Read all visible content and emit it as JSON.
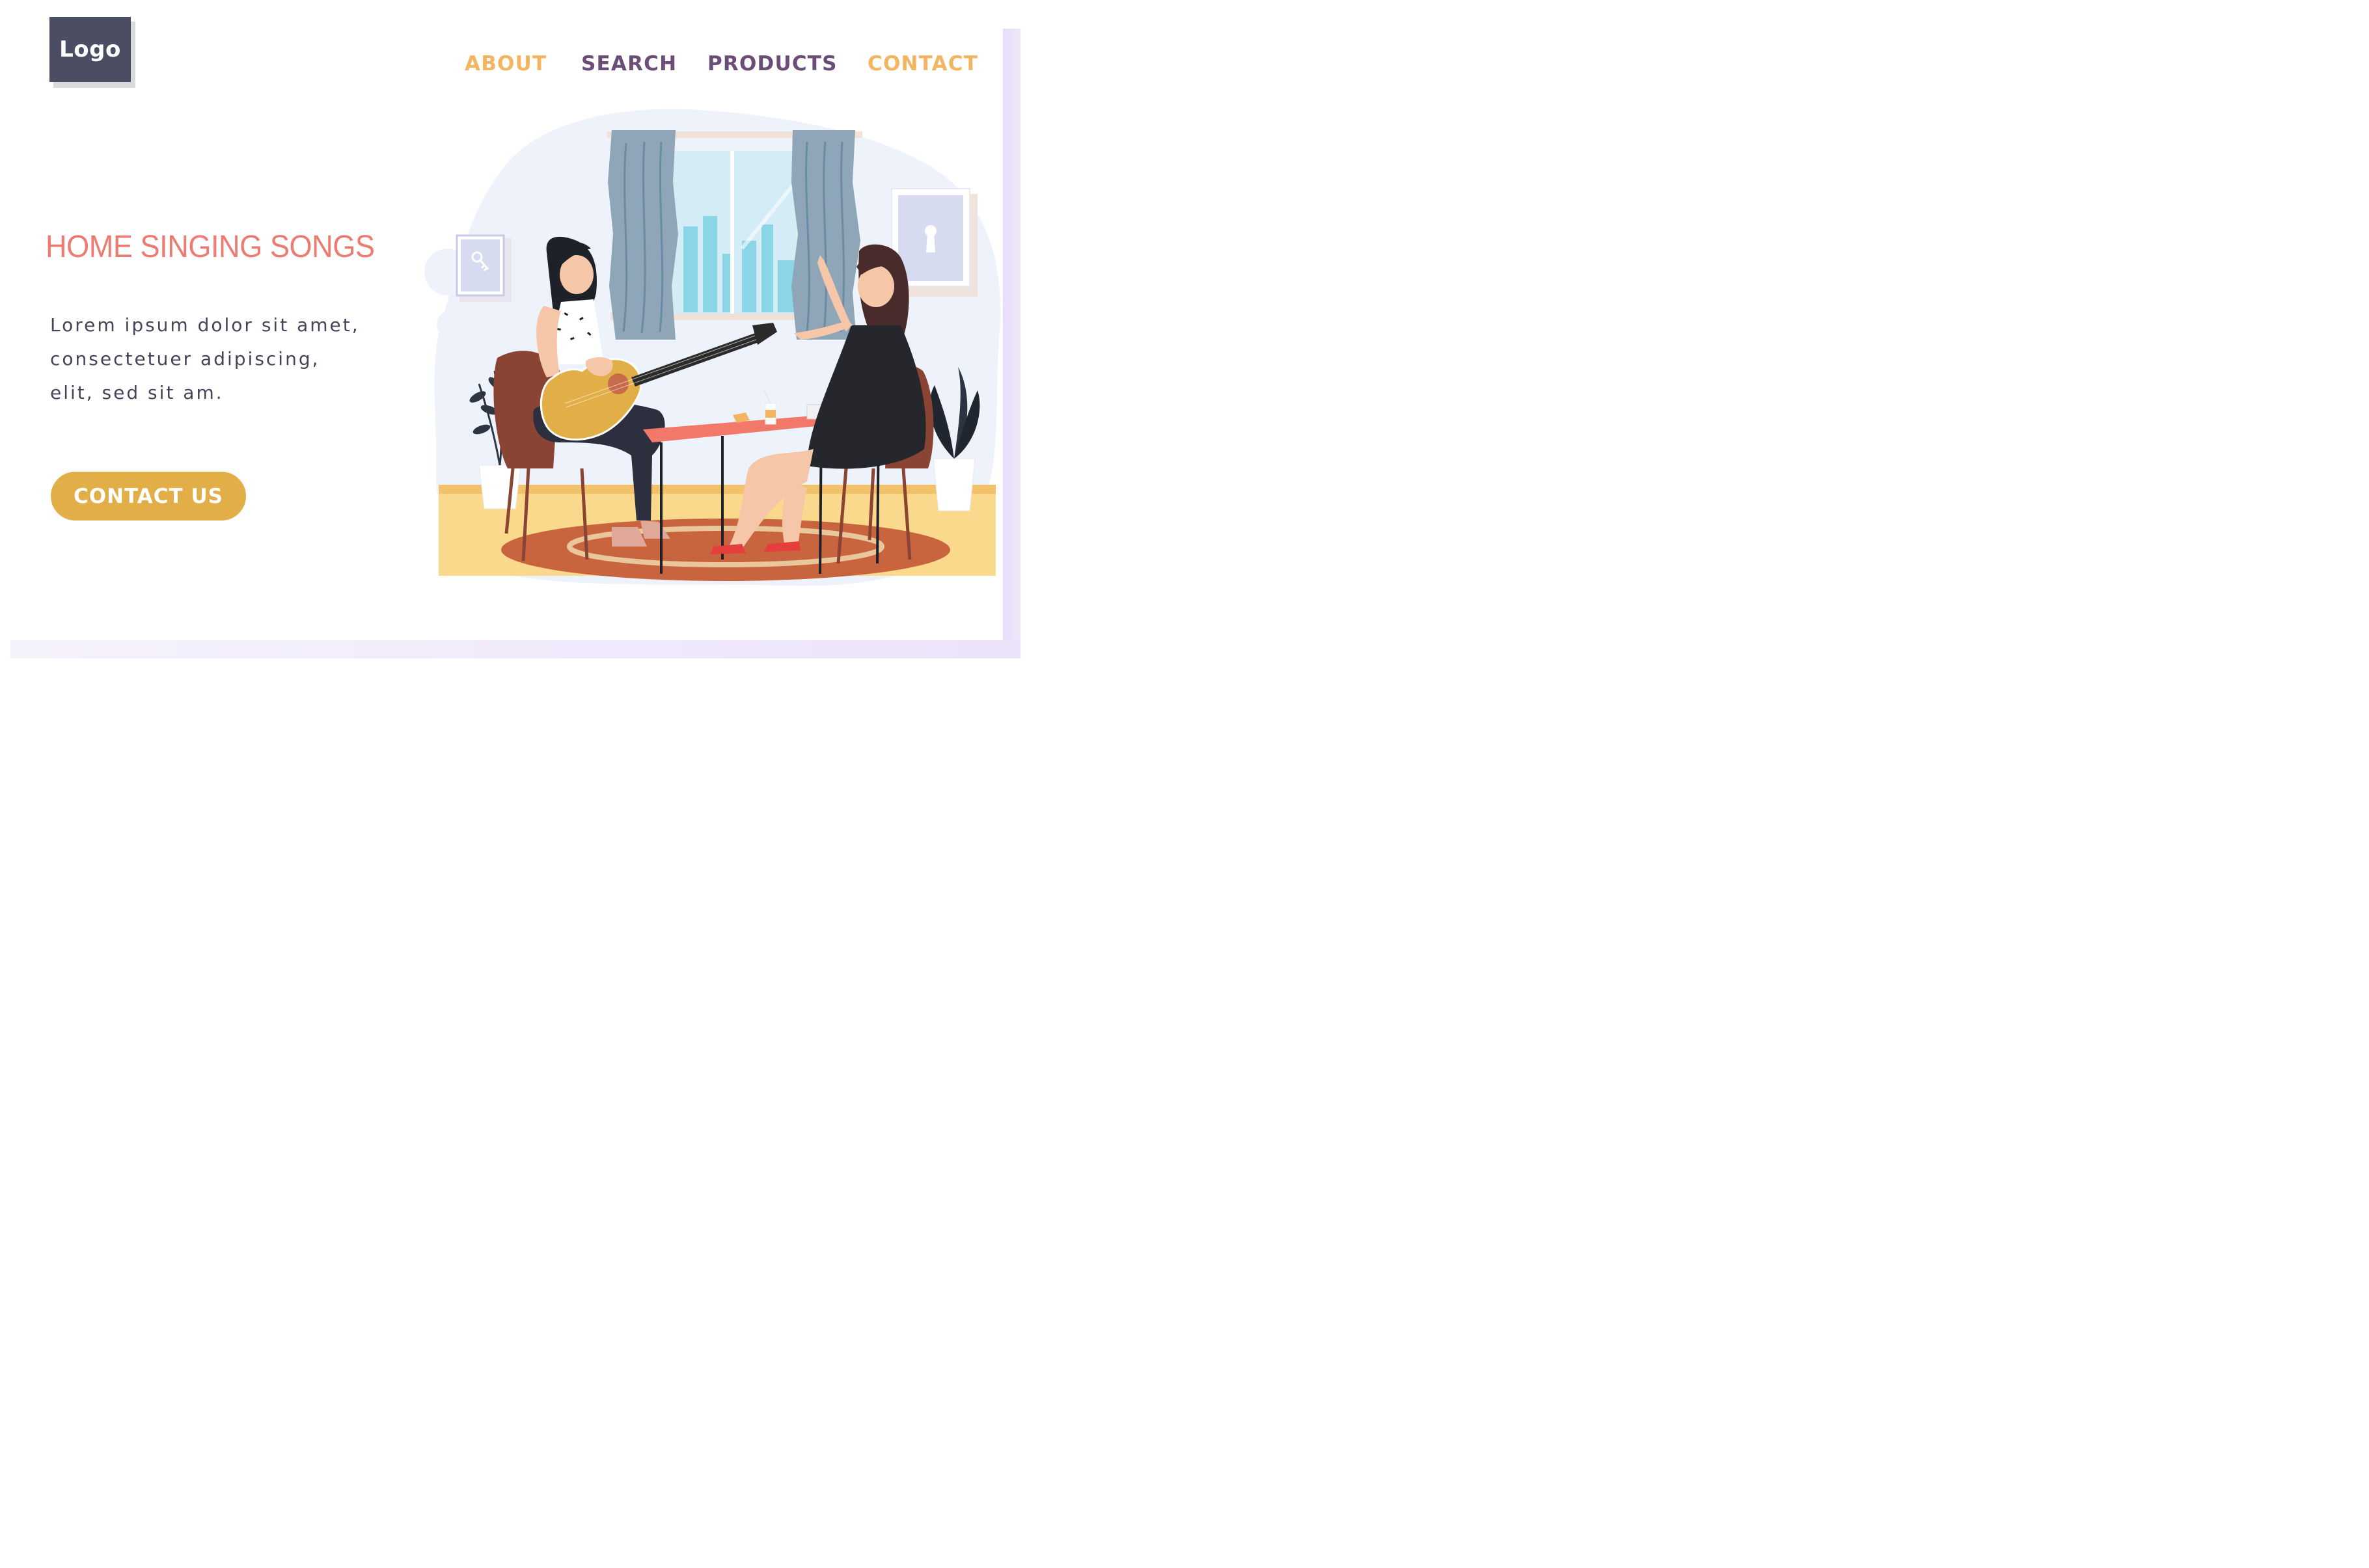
{
  "brand": {
    "logo_text": "Logo"
  },
  "nav": {
    "items": [
      {
        "label": "ABOUT"
      },
      {
        "label": "SEARCH"
      },
      {
        "label": "PRODUCTS"
      },
      {
        "label": "CONTACT"
      }
    ]
  },
  "hero": {
    "title": "HOME SINGING SONGS",
    "body_lines": [
      "Lorem ipsum dolor sit amet,",
      "consectetuer adipiscing,",
      "elit, sed sit am."
    ],
    "cta_label": "CONTACT US"
  },
  "illustration": {
    "subject": "two women at home, one playing acoustic guitar, sitting at a red table by a window"
  },
  "colors": {
    "nav_orange": "#f3b562",
    "nav_purple": "#6b4e78",
    "title_coral": "#ee7b72",
    "cta_gold": "#e2ae48",
    "logo_bg": "#4b4e63"
  }
}
